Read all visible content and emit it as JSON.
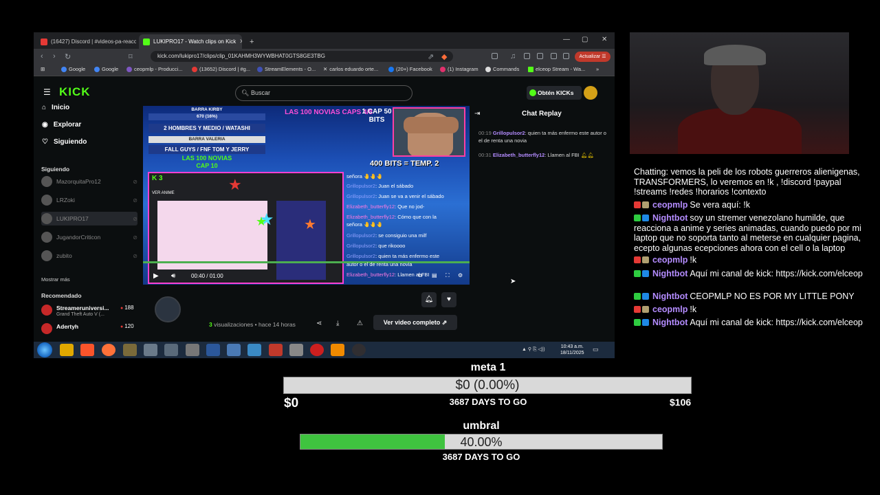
{
  "browser": {
    "tabs": [
      {
        "label": "(16427) Discord | #videos-pa-reacciona",
        "active": false
      },
      {
        "label": "LUKIPRO17 - Watch clips on Kick",
        "active": true
      }
    ],
    "new_tab": "+",
    "url": "kick.com/lukipro17/clips/clip_01KAHMH3WYWBHAT0GTS8GE3TBG",
    "update_label": "Actualizar",
    "bookmarks": [
      "Google",
      "Google",
      "ceopmlp - Producci...",
      "(13652) Discord | #g...",
      "StreamElements - O...",
      "carlos eduardo orte...",
      "(20+) Facebook",
      "(1) Instagram",
      "Commands",
      "elceop Stream - Wa..."
    ]
  },
  "kick": {
    "logo": "KICK",
    "search_placeholder": "Buscar",
    "kicks_button": "Obtén KICKs",
    "nav": [
      {
        "label": "Inicio",
        "icon": "home-icon"
      },
      {
        "label": "Explorar",
        "icon": "compass-icon"
      },
      {
        "label": "Siguiendo",
        "icon": "heart-icon"
      }
    ],
    "following_heading": "Siguiendo",
    "following": [
      "MazorquitaPro12",
      "LRZoki",
      "LUKIPRO17",
      "JugandorCriticon",
      "zubito"
    ],
    "show_more": "Mostrar más",
    "recommended_heading": "Recomendado",
    "recommended": [
      {
        "name": "Streameruniversi...",
        "game": "Grand Theft Auto V (...",
        "viewers": "188"
      },
      {
        "name": "Adertyh",
        "game": "",
        "viewers": "120"
      }
    ],
    "video": {
      "banner": [
        "BARRA KIRBY",
        "670 (16%)",
        "2 HOMBRES Y MEDIO / WATASHI",
        "BARRA VALERIA",
        "FALL GUYS / FNF TOM Y JERRY",
        "LAS 100 NOVIAS",
        "CAP 10"
      ],
      "banner_values": {
        "kirby_min": "100",
        "kirby_max": "4000",
        "valeria_min": "100",
        "valeria_max": "1000"
      },
      "title": "LAS 100 NOVIAS CAPS 4/8",
      "cap": "1 CAP 50 BITS",
      "bits": "400 BITS = TEMP. 2",
      "inner_badge": "K 3",
      "inner_title": "VER ANIME",
      "chat": [
        {
          "user": "",
          "text": "señora 🤚🤚🤚"
        },
        {
          "user": "Grillopulsor2",
          "text": ": Juan el sábado"
        },
        {
          "user": "Grillopulsor2",
          "text": ": Juan se va a venir el sábado"
        },
        {
          "user": "Elizabeth_butterfly12",
          "text": ": Que no jod-"
        },
        {
          "user": "Elizabeth_butterfly12",
          "text": ": Cómo que con la"
        },
        {
          "user": "",
          "text": "señora 🤚🤚🤚"
        },
        {
          "user": "Grillopulsor2",
          "text": ": se consiguio una milf"
        },
        {
          "user": "Grillopulsor2",
          "text": ": que rikoooo"
        },
        {
          "user": "Grillopulsor2",
          "text": ": quien ta más enfermo este"
        },
        {
          "user": "",
          "text": "autor o el de renta una novia"
        },
        {
          "user": "Elizabeth_butterfly12",
          "text": ": Llamen al FBI"
        }
      ],
      "time": "00:40 / 01:00",
      "progress": 0.67
    },
    "clip": {
      "views_count": "3",
      "views_label": "visualizaciones",
      "ago": "hace 14 horas",
      "full_video": "Ver video completo"
    },
    "chat_replay": {
      "title": "Chat Replay",
      "messages": [
        {
          "time": "00:19",
          "user": "Grillopulsor2",
          "text": ": quien ta más enfermo este autor o el de renta una novia"
        },
        {
          "time": "00:31",
          "user": "Elizabeth_butterfly12",
          "text": ": Llamen al FBI"
        }
      ]
    }
  },
  "taskbar": {
    "time": "10:43 a.m.",
    "date": "18/11/2025"
  },
  "overlay_chat": [
    {
      "user": "",
      "text": "Chatting: vemos la peli de los robots guerreros alienigenas, TRANSFORMERS, lo veremos en !k , !discord !paypal !streams !redes !horarios !contexto"
    },
    {
      "user": "ceopmlp",
      "text": "Se vera aquí: !k"
    },
    {
      "user": "Nightbot",
      "text": "soy un stremer venezolano humilde, que reacciona a anime y series animadas, cuando puedo por mi laptop que no soporta tanto al meterse en cualquier pagina, ecepto algunas ecepciones ahora con el cell o la laptop"
    },
    {
      "user": "ceopmlp",
      "text": "!k"
    },
    {
      "user": "Nightbot",
      "text": "Aquí mi canal de kick: https://kick.com/elceop"
    },
    {
      "user": "Nightbot",
      "text": "CEOPMLP NO ES POR MY LITTLE PONY"
    },
    {
      "user": "ceopmlp",
      "text": "!k"
    },
    {
      "user": "Nightbot",
      "text": "Aquí mi canal de kick: https://kick.com/elceop"
    }
  ],
  "goals": [
    {
      "title": "meta 1",
      "bar_text": "$0 (0.00%)",
      "progress": 0.0,
      "sub": "3687 DAYS TO GO",
      "min": "$0",
      "max": "$106"
    },
    {
      "title": "umbral",
      "bar_text": "40.00%",
      "progress": 0.4,
      "sub": "3687 DAYS TO GO"
    }
  ],
  "colors": {
    "kick_green": "#53fc18",
    "username_purple": "#b48cff",
    "goal_green": "#3fc33f"
  }
}
